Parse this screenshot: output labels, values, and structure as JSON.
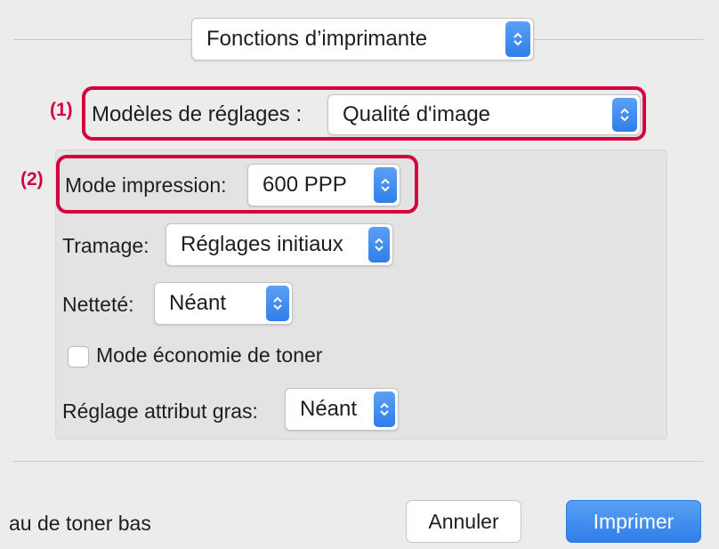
{
  "header": {
    "section_popup": {
      "value": "Fonctions d’imprimante"
    }
  },
  "callouts": {
    "one": "(1)",
    "two": "(2)"
  },
  "presets": {
    "label": "Modèles de réglages :",
    "value": "Qualité d'image"
  },
  "settings": {
    "print_mode": {
      "label": "Mode impression:",
      "value": "600 PPP"
    },
    "halftone": {
      "label": "Tramage:",
      "value": "Réglages initiaux"
    },
    "sharpness": {
      "label": "Netteté:",
      "value": "Néant"
    },
    "toner_save": {
      "label": "Mode économie de toner",
      "checked": false
    },
    "bold_attribute": {
      "label": "Réglage attribut gras:",
      "value": "Néant"
    }
  },
  "footer": {
    "status_text": "au de toner bas",
    "cancel_label": "Annuler",
    "print_label": "Imprimer"
  },
  "colors": {
    "accent": "#2f7ee9",
    "callout": "#d5003e"
  },
  "icons": {
    "popup_stepper": "updown-chevron-icon"
  }
}
